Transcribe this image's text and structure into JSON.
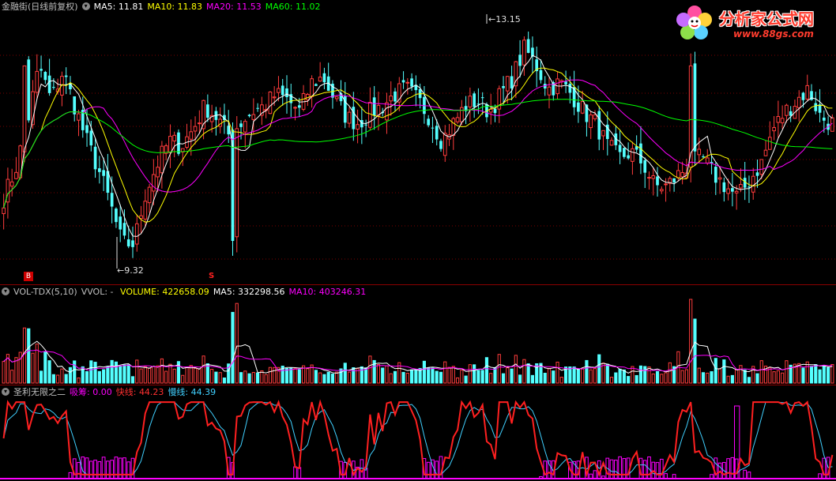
{
  "price_header": {
    "title": "金融街(日线前复权)",
    "ma5_label": "MA5:",
    "ma5_value": "11.81",
    "ma10_label": "MA10:",
    "ma10_value": "11.83",
    "ma20_label": "MA20:",
    "ma20_value": "11.53",
    "ma60_label": "MA60:",
    "ma60_value": "11.02"
  },
  "price_annotations": {
    "high": "13.15",
    "low": "9.32",
    "buy_marker": "B",
    "sell_marker": "S"
  },
  "volume_header": {
    "indicator": "VOL-TDX(5,10)",
    "vvol_label": "VVOL:",
    "vvol_value": "-",
    "volume_label": "VOLUME:",
    "volume_value": "422658.09",
    "ma5_label": "MA5:",
    "ma5_value": "332298.56",
    "ma10_label": "MA10:",
    "ma10_value": "403246.31"
  },
  "indicator_header": {
    "name": "圣利无限之二",
    "xichou_label": "吸筹:",
    "xichou_value": "0.00",
    "kuai_label": "快线:",
    "kuai_value": "44.23",
    "man_label": "慢线:",
    "man_value": "44.39"
  },
  "logo": {
    "title": "分析家公式网",
    "url": "www.88gs.com"
  },
  "colors": {
    "background": "#000000",
    "separator": "#8a0000",
    "up": "#ff3c3c",
    "down": "#54ffff",
    "ma5": "#ffffff",
    "ma10": "#ffff00",
    "ma20": "#ff00ff",
    "ma60": "#00ff00",
    "fast": "#ff2020",
    "slow": "#40d0ff",
    "absorb": "#ff00ff"
  },
  "chart_data": [
    {
      "type": "candlestick",
      "title": "金融街(日线前复权)",
      "ylim": [
        9.0,
        13.5
      ],
      "series_points": 200,
      "annotated_high": 13.15,
      "annotated_low": 9.32,
      "moving_averages": [
        {
          "name": "MA5",
          "last": 11.81
        },
        {
          "name": "MA10",
          "last": 11.83
        },
        {
          "name": "MA20",
          "last": 11.53
        },
        {
          "name": "MA60",
          "last": 11.02
        }
      ],
      "price_path": [
        10.3,
        10.8,
        11.6,
        12.6,
        12.0,
        12.5,
        11.9,
        11.3,
        10.8,
        10.2,
        9.5,
        9.5,
        10.4,
        10.9,
        11.3,
        11.2,
        11.5,
        11.9,
        11.7,
        11.4,
        11.6,
        11.8,
        11.9,
        12.1,
        12.0,
        11.8,
        12.3,
        12.4,
        12.0,
        11.7,
        11.6,
        11.8,
        11.9,
        12.1,
        12.2,
        12.0,
        11.7,
        11.3,
        11.6,
        11.9,
        12.0,
        11.8,
        12.1,
        12.4,
        12.9,
        12.6,
        12.2,
        12.3,
        12.1,
        11.8,
        11.6,
        11.2,
        11.0,
        11.1,
        10.9,
        10.5,
        10.5,
        10.7,
        10.9,
        11.0,
        10.7,
        10.5,
        10.3,
        10.6,
        10.9,
        11.5,
        11.8,
        12.0,
        12.2,
        11.7,
        11.6
      ],
      "grid": "dotted"
    },
    {
      "type": "bar",
      "title": "VOL-TDX(5,10)",
      "series": [
        {
          "name": "VOLUME",
          "last": 422658.09
        },
        {
          "name": "MA5",
          "last": 332298.56
        },
        {
          "name": "MA10",
          "last": 403246.31
        }
      ]
    },
    {
      "type": "line",
      "title": "圣利无限之二",
      "ylim": [
        0,
        100
      ],
      "series": [
        {
          "name": "吸筹",
          "last": 0.0
        },
        {
          "name": "快线",
          "last": 44.23
        },
        {
          "name": "慢线",
          "last": 44.39
        }
      ]
    }
  ]
}
